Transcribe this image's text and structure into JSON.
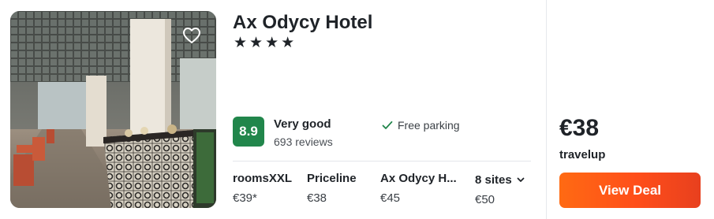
{
  "hotel": {
    "name": "Ax Odycy Hotel",
    "stars_text": "★★★★",
    "star_count": 4
  },
  "rating": {
    "score": "8.9",
    "label": "Very good",
    "reviews": "693 reviews",
    "badge_color": "#21864b"
  },
  "amenities": [
    {
      "icon": "check-icon",
      "label": "Free parking"
    }
  ],
  "offers": [
    {
      "site": "roomsXXL",
      "price": "€39*"
    },
    {
      "site": "Priceline",
      "price": "€38"
    },
    {
      "site": "Ax Odycy H...",
      "price": "€45"
    }
  ],
  "more_sites": {
    "label": "8 sites",
    "price": "€50",
    "icon": "chevron-down-icon"
  },
  "best_deal": {
    "price": "€38",
    "site": "travelup",
    "button_label": "View Deal",
    "button_color": "#ff5a16"
  },
  "favorite": {
    "icon": "heart-icon"
  }
}
